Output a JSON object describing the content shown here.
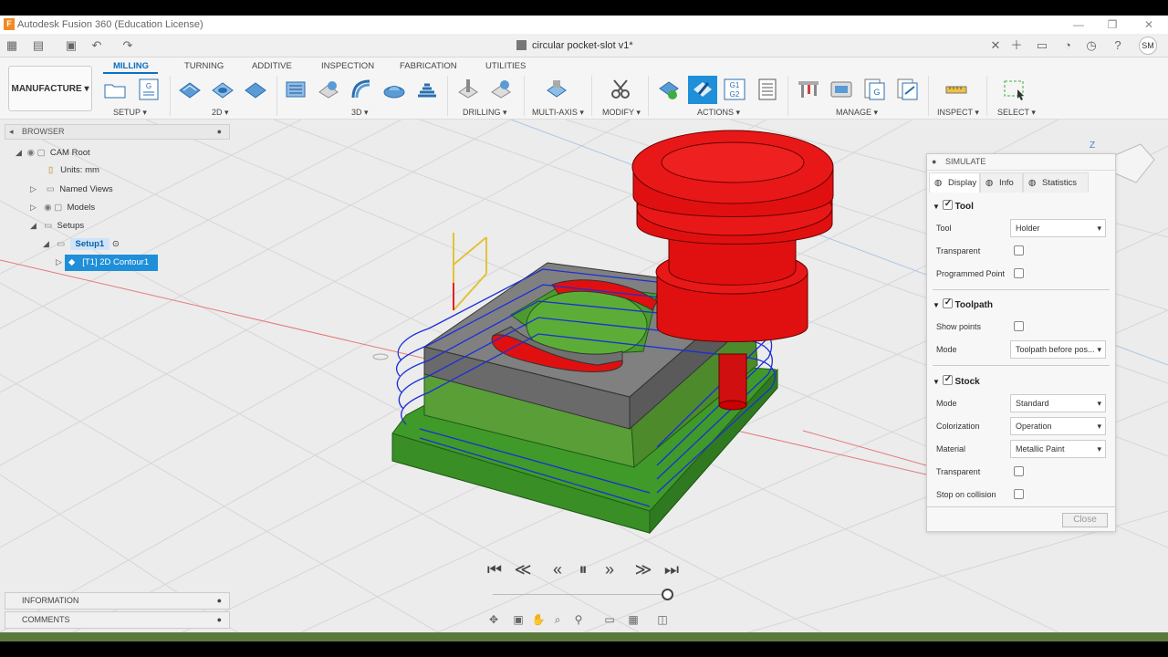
{
  "window": {
    "title": "Autodesk Fusion 360 (Education License)",
    "logo": "F"
  },
  "doc": {
    "name": "circular pocket-slot v1*",
    "user": "SM"
  },
  "workspace": "MANUFACTURE",
  "tabs": [
    "MILLING",
    "TURNING",
    "ADDITIVE",
    "INSPECTION",
    "FABRICATION",
    "UTILITIES"
  ],
  "groups": [
    "SETUP",
    "2D",
    "3D",
    "DRILLING",
    "MULTI-AXIS",
    "MODIFY",
    "ACTIONS",
    "MANAGE",
    "INSPECT",
    "SELECT"
  ],
  "browser": {
    "title": "BROWSER",
    "items": [
      "CAM Root",
      "Units: mm",
      "Named Views",
      "Models",
      "Setups",
      "Setup1",
      "[T1] 2D Contour1"
    ]
  },
  "bottom_panels": [
    "INFORMATION",
    "COMMENTS"
  ],
  "simulate": {
    "title": "SIMULATE",
    "tabs": [
      "Display",
      "Info",
      "Statistics"
    ],
    "tool": {
      "label": "Tool",
      "tool_row": "Tool",
      "tool_value": "Holder",
      "transparent": "Transparent",
      "programmed": "Programmed Point"
    },
    "toolpath": {
      "label": "Toolpath",
      "show_points": "Show points",
      "mode": "Mode",
      "mode_value": "Toolpath before pos..."
    },
    "stock": {
      "label": "Stock",
      "mode": "Mode",
      "mode_value": "Standard",
      "color": "Colorization",
      "color_value": "Operation",
      "material": "Material",
      "material_value": "Metallic Paint",
      "transparent": "Transparent",
      "stop": "Stop on collision"
    },
    "close": "Close"
  },
  "colors": {
    "accent": "#0a6fc2",
    "stock": "#3f9a2a",
    "tool": "#e01010",
    "toolpath": "#1a2fd6"
  }
}
